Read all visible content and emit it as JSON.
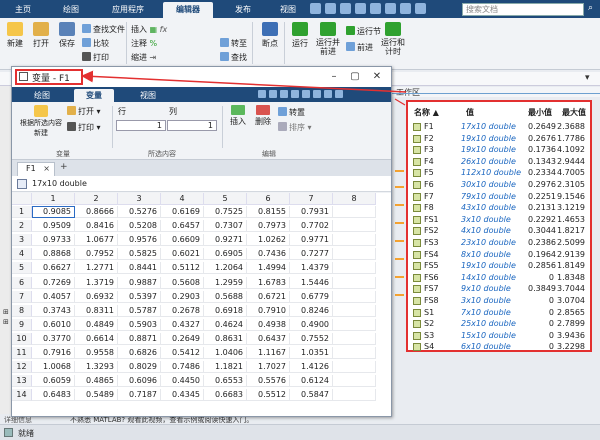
{
  "main": {
    "tabs": [
      "主页",
      "绘图",
      "应用程序",
      "编辑器",
      "发布",
      "视图"
    ],
    "search_placeholder": "搜索文档",
    "ribbon": {
      "new": "新建",
      "open": "打开",
      "save": "保存",
      "find_files": "查找文件",
      "compare": "比较",
      "print": "打印",
      "insert": "插入",
      "comment": "注释",
      "indent": "缩进",
      "goto": "转至",
      "find": "查找",
      "breakpoints": "断点",
      "run": "运行",
      "run_advance": "运行并\n前进",
      "run_section": "运行节",
      "advance": "前进",
      "run_time": "运行和\n计时"
    },
    "workspace_title": "工作区",
    "status_left": "详细信息",
    "status_text": "就绪",
    "banner_text": "不熟悉 MATLAB? 观看此视频，查看示例或阅读快速入门。"
  },
  "workspace": {
    "headers": {
      "name": "名称 ▲",
      "value": "值",
      "min": "最小值",
      "max": "最大值"
    },
    "rows": [
      {
        "name": "F1",
        "value": "17x10 double",
        "min": "0.2649",
        "max": "2.3688"
      },
      {
        "name": "F2",
        "value": "19x10 double",
        "min": "0.2676",
        "max": "1.7786"
      },
      {
        "name": "F3",
        "value": "19x10 double",
        "min": "0.1736",
        "max": "4.1092"
      },
      {
        "name": "F4",
        "value": "26x10 double",
        "min": "0.1343",
        "max": "2.9444"
      },
      {
        "name": "F5",
        "value": "112x10 double",
        "min": "0.2334",
        "max": "4.7005"
      },
      {
        "name": "F6",
        "value": "30x10 double",
        "min": "0.2976",
        "max": "2.3105"
      },
      {
        "name": "F7",
        "value": "79x10 double",
        "min": "0.2251",
        "max": "9.1546"
      },
      {
        "name": "F8",
        "value": "43x10 double",
        "min": "0.2131",
        "max": "3.1219"
      },
      {
        "name": "FS1",
        "value": "3x10 double",
        "min": "0.2292",
        "max": "1.4653"
      },
      {
        "name": "FS2",
        "value": "4x10 double",
        "min": "0.3044",
        "max": "1.8217"
      },
      {
        "name": "FS3",
        "value": "23x10 double",
        "min": "0.2386",
        "max": "2.5099"
      },
      {
        "name": "FS4",
        "value": "8x10 double",
        "min": "0.1964",
        "max": "2.9139"
      },
      {
        "name": "FS5",
        "value": "19x10 double",
        "min": "0.2856",
        "max": "1.8149"
      },
      {
        "name": "FS6",
        "value": "14x10 double",
        "min": "0",
        "max": "1.8348"
      },
      {
        "name": "FS7",
        "value": "9x10 double",
        "min": "0.3849",
        "max": "3.7044"
      },
      {
        "name": "FS8",
        "value": "3x10 double",
        "min": "0",
        "max": "3.0704"
      },
      {
        "name": "S1",
        "value": "7x10 double",
        "min": "0",
        "max": "2.8565"
      },
      {
        "name": "S2",
        "value": "25x10 double",
        "min": "0",
        "max": "2.7899"
      },
      {
        "name": "S3",
        "value": "15x10 double",
        "min": "0",
        "max": "3.9436"
      },
      {
        "name": "S4",
        "value": "6x10 double",
        "min": "0",
        "max": "3.2298"
      }
    ]
  },
  "variable_window": {
    "title": "变量 - F1",
    "tabs": [
      "绘图",
      "变量",
      "视图"
    ],
    "ribbon": {
      "new_from_selection": "根据所选内容\n新建",
      "open": "打开",
      "print": "打印",
      "rows_label": "行",
      "cols_label": "列",
      "rows_value": "1",
      "cols_value": "1",
      "insert": "插入",
      "delete": "删除",
      "transpose": "转置",
      "sort": "排序",
      "group_variable": "变量",
      "group_selection": "所选内容",
      "group_edit": "编辑"
    },
    "doc_tab": "F1",
    "size_info": "17x10 double",
    "col_headers": [
      "1",
      "2",
      "3",
      "4",
      "5",
      "6",
      "7",
      "8"
    ],
    "rows": [
      [
        "0.9085",
        "0.8666",
        "0.5276",
        "0.6169",
        "0.7525",
        "0.8155",
        "0.7931"
      ],
      [
        "0.9509",
        "0.8416",
        "0.5208",
        "0.6457",
        "0.7307",
        "0.7973",
        "0.7702"
      ],
      [
        "0.9733",
        "1.0677",
        "0.9576",
        "0.6609",
        "0.9271",
        "1.0262",
        "0.9771"
      ],
      [
        "0.8868",
        "0.7952",
        "0.5825",
        "0.6021",
        "0.6905",
        "0.7436",
        "0.7277"
      ],
      [
        "0.6627",
        "1.2771",
        "0.8441",
        "0.5112",
        "1.2064",
        "1.4994",
        "1.4379"
      ],
      [
        "0.7269",
        "1.3719",
        "0.9887",
        "0.5608",
        "1.2959",
        "1.6783",
        "1.5446"
      ],
      [
        "0.4057",
        "0.6932",
        "0.5397",
        "0.2903",
        "0.5688",
        "0.6721",
        "0.6779"
      ],
      [
        "0.3743",
        "0.8311",
        "0.5787",
        "0.2678",
        "0.6918",
        "0.7910",
        "0.8246"
      ],
      [
        "0.6010",
        "0.4849",
        "0.5903",
        "0.4327",
        "0.4624",
        "0.4938",
        "0.4900"
      ],
      [
        "0.3770",
        "0.6614",
        "0.8871",
        "0.2649",
        "0.8631",
        "0.6437",
        "0.7552"
      ],
      [
        "0.7916",
        "0.9558",
        "0.6826",
        "0.5412",
        "1.0406",
        "1.1167",
        "1.0351"
      ],
      [
        "1.0068",
        "1.3293",
        "0.8029",
        "0.7486",
        "1.1821",
        "1.7027",
        "1.4126"
      ],
      [
        "0.6059",
        "0.4865",
        "0.6096",
        "0.4450",
        "0.6553",
        "0.5576",
        "0.6124"
      ],
      [
        "0.6483",
        "0.5489",
        "0.7187",
        "0.4345",
        "0.6683",
        "0.5512",
        "0.5847"
      ]
    ]
  },
  "colors": {
    "accent": "#1f4a7a",
    "highlight": "#e33030",
    "orange": "#f5a230",
    "link": "#1a66c0"
  }
}
